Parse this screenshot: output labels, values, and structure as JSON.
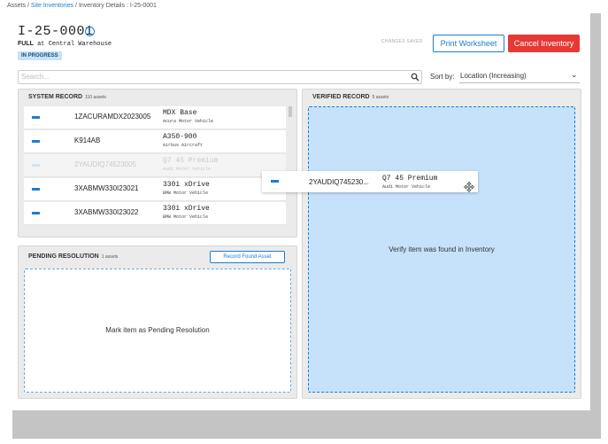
{
  "breadcrumb": {
    "assets": "Assets",
    "sep1": " / ",
    "site": "Site Inventories",
    "sep2": " / ",
    "details": "Inventory Details : I-25-0001"
  },
  "header": {
    "title": "I-25-0001",
    "info_icon": "info-icon",
    "type": "FULL",
    "at": " at ",
    "location": "Central Warehouse",
    "status": "IN PROGRESS",
    "changes_saved": "CHANGES SAVED",
    "print_label": "Print Worksheet",
    "cancel_label": "Cancel Inventory"
  },
  "search": {
    "placeholder": "Search...",
    "icon": "search-icon"
  },
  "sort": {
    "label": "Sort by:",
    "value": "Location (Increasing)",
    "icon": "chevron-down-icon"
  },
  "system_record": {
    "title": "SYSTEM RECORD",
    "count": "110 assets",
    "rows": [
      {
        "vin": "1ZACURAMDX2023005",
        "model": "MDX Base",
        "make": "Acura Motor Vehicle",
        "ghost": false
      },
      {
        "vin": "K914AB",
        "model": "A350-900",
        "make": "Airbus Aircraft",
        "ghost": false
      },
      {
        "vin": "2YAUDIQ74523005",
        "model": "Q7 45 Premium",
        "make": "Audi Motor Vehicle",
        "ghost": true
      },
      {
        "vin": "3XABMW330I23021",
        "model": "330i xDrive",
        "make": "BMW Motor Vehicle",
        "ghost": false
      },
      {
        "vin": "3XABMW330I23022",
        "model": "330i xDrive",
        "make": "BMW Motor Vehicle",
        "ghost": false
      }
    ]
  },
  "verified_record": {
    "title": "VERIFIED RECORD",
    "count": "5 assets",
    "drop_text": "Verify item was found in Inventory"
  },
  "pending": {
    "title": "PENDING RESOLUTION",
    "count": "1 assets",
    "button_label": "Record Found Asset",
    "drop_text": "Mark item as Pending Resolution"
  },
  "drag_card": {
    "vin": "2YAUDIQ745230...",
    "model": "Q7 45 Premium",
    "make": "Audi Motor Vehicle",
    "icon": "move-icon"
  },
  "colors": {
    "accent": "#1a7fd1",
    "danger": "#e53935",
    "badge_bg": "#c7e3f7",
    "dropzone_bg": "#c6e2fa"
  }
}
